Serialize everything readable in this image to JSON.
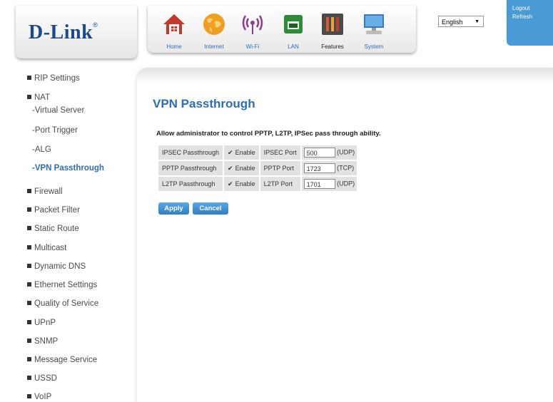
{
  "brand": {
    "name": "D-Link",
    "reg": "®"
  },
  "nav": [
    {
      "label": "Home",
      "icon": "home-icon"
    },
    {
      "label": "Internet",
      "icon": "globe-icon"
    },
    {
      "label": "Wi-Fi",
      "icon": "wifi-icon"
    },
    {
      "label": "LAN",
      "icon": "lan-icon"
    },
    {
      "label": "Features",
      "icon": "features-icon"
    },
    {
      "label": "System",
      "icon": "monitor-icon"
    }
  ],
  "language": {
    "selected": "English"
  },
  "account": {
    "logout": "Logout",
    "refresh": "Refresh"
  },
  "sidebar": {
    "items": [
      {
        "label": "RIP Settings"
      },
      {
        "label": "NAT"
      },
      {
        "label": "Firewall"
      },
      {
        "label": "Packet Filter"
      },
      {
        "label": "Static Route"
      },
      {
        "label": "Multicast"
      },
      {
        "label": "Dynamic DNS"
      },
      {
        "label": "Ethernet Settings"
      },
      {
        "label": "Quality of Service"
      },
      {
        "label": "UPnP"
      },
      {
        "label": "SNMP"
      },
      {
        "label": "Message Service"
      },
      {
        "label": "USSD"
      },
      {
        "label": "VoIP"
      }
    ],
    "nat_sub": [
      {
        "label": "-Virtual Server"
      },
      {
        "label": "-Port Trigger"
      },
      {
        "label": "-ALG"
      },
      {
        "label": "-VPN Passthrough",
        "active": true
      }
    ]
  },
  "main": {
    "title": "VPN Passthrough",
    "description": "Allow administrator to control PPTP, L2TP, IPSec pass through ability.",
    "rows": [
      {
        "name": "IPSEC Passthrough",
        "enable_label": "Enable",
        "checked": true,
        "port_label": "IPSEC Port",
        "port_value": "500",
        "protocol": "(UDP)"
      },
      {
        "name": "PPTP Passthrough",
        "enable_label": "Enable",
        "checked": true,
        "port_label": "PPTP Port",
        "port_value": "1723",
        "protocol": "(TCP)"
      },
      {
        "name": "L2TP Passthrough",
        "enable_label": "Enable",
        "checked": true,
        "port_label": "L2TP Port",
        "port_value": "1701",
        "protocol": "(UDP)"
      }
    ],
    "apply_label": "Apply",
    "cancel_label": "Cancel"
  },
  "colors": {
    "accent": "#2e6db4",
    "logout_bg": "#4a9ad6"
  }
}
